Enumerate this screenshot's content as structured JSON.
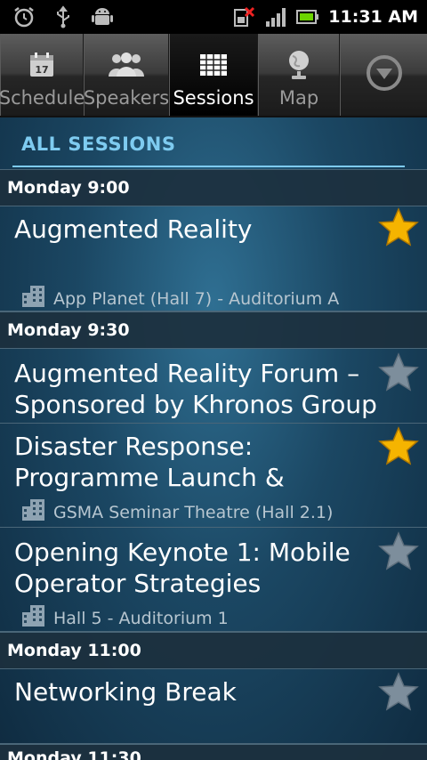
{
  "status_bar": {
    "time": "11:31 AM",
    "icons": [
      "alarm-clock-icon",
      "usb-icon",
      "android-icon",
      "no-sim-icon",
      "signal-icon",
      "battery-icon"
    ]
  },
  "tabs": [
    {
      "label": "Schedule",
      "icon": "calendar-icon",
      "active": false
    },
    {
      "label": "Speakers",
      "icon": "people-icon",
      "active": false
    },
    {
      "label": "Sessions",
      "icon": "grid-icon",
      "active": true
    },
    {
      "label": "Map",
      "icon": "globe-icon",
      "active": false
    }
  ],
  "more_icon": "chevron-down-circle-icon",
  "section": {
    "title": "ALL SESSIONS"
  },
  "groups": [
    {
      "time": "Monday 9:00",
      "items": [
        {
          "title": "Augmented Reality",
          "venue": "App Planet (Hall 7) - Auditorium A",
          "starred": true
        }
      ]
    },
    {
      "time": "Monday 9:30",
      "items": [
        {
          "title": "Augmented Reality Forum – Sponsored by Khronos Group",
          "venue": "",
          "starred": false
        },
        {
          "title": "Disaster Response: Programme Launch &",
          "venue": "GSMA Seminar Theatre (Hall 2.1)",
          "starred": true
        },
        {
          "title": "Opening Keynote 1: Mobile Operator Strategies",
          "venue": "Hall 5 - Auditorium 1",
          "starred": false
        }
      ]
    },
    {
      "time": "Monday 11:00",
      "items": [
        {
          "title": "Networking Break",
          "venue": "",
          "starred": false
        }
      ]
    }
  ],
  "next_group_peek": "Monday 11:30",
  "colors": {
    "accent": "#7ecbf0",
    "star_on": "#f5b400",
    "star_off": "#7d8e9c"
  }
}
